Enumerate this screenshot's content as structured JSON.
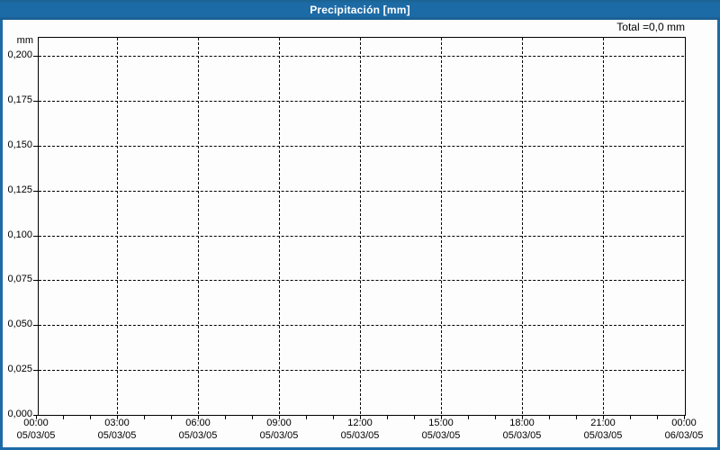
{
  "window": {
    "title": "Precipitación [mm]"
  },
  "chart": {
    "total_label": "Total =0,0 mm",
    "y_axis": {
      "unit": "mm",
      "tick_labels": [
        "0,200",
        "0,175",
        "0,150",
        "0,125",
        "0,100",
        "0,075",
        "0,050",
        "0,025",
        "0,000"
      ]
    },
    "x_axis": {
      "tick_labels": [
        {
          "time": "00:00",
          "date": "05/03/05"
        },
        {
          "time": "03:00",
          "date": "05/03/05"
        },
        {
          "time": "06:00",
          "date": "05/03/05"
        },
        {
          "time": "09:00",
          "date": "05/03/05"
        },
        {
          "time": "12:00",
          "date": "05/03/05"
        },
        {
          "time": "15:00",
          "date": "05/03/05"
        },
        {
          "time": "18:00",
          "date": "05/03/05"
        },
        {
          "time": "21:00",
          "date": "05/03/05"
        },
        {
          "time": "00:00",
          "date": "06/03/05"
        }
      ]
    }
  },
  "colors": {
    "accent_blue": "#1d6ba6",
    "titlebar_text": "#ffffff",
    "grid_line": "#000000"
  },
  "chart_data": {
    "type": "line",
    "title": "Precipitación [mm]",
    "ylabel": "mm",
    "xlabel": "",
    "x": [
      "05/03/05 00:00",
      "05/03/05 03:00",
      "05/03/05 06:00",
      "05/03/05 09:00",
      "05/03/05 12:00",
      "05/03/05 15:00",
      "05/03/05 18:00",
      "05/03/05 21:00",
      "06/03/05 00:00"
    ],
    "series": [
      {
        "name": "Precipitación",
        "values": [
          0,
          0,
          0,
          0,
          0,
          0,
          0,
          0,
          0
        ]
      }
    ],
    "total_annotation": "Total =0,0 mm",
    "ylim": [
      0,
      0.21
    ],
    "y_tick_step": 0.025,
    "x_minor_tick_hours": 1,
    "grid": true,
    "grid_style": "dashed",
    "legend_position": "none"
  }
}
